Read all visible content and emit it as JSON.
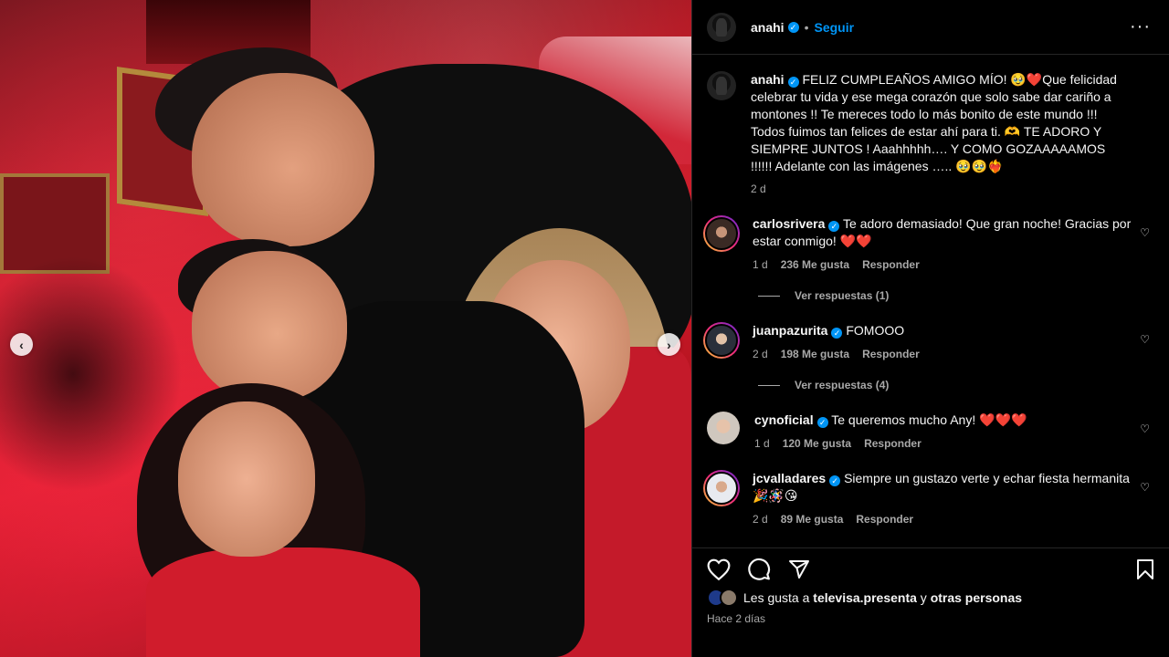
{
  "header": {
    "username": "anahi",
    "follow_label": "Seguir",
    "more_icon": "···"
  },
  "caption": {
    "username": "anahi",
    "text": "FELIZ CUMPLEAÑOS AMIGO MÍO! 🥹❤️Que felicidad celebrar tu vida y ese mega corazón que solo sabe dar cariño a montones !! Te mereces todo lo más bonito de este mundo !!! Todos fuimos tan felices de estar ahí para ti. 🫶 TE ADORO Y SIEMPRE JUNTOS ! Aaahhhhh…. Y COMO GOZAAAAAMOS !!!!!! Adelante con las imágenes ….. 🥹🥹❤️‍🔥",
    "time": "2 d"
  },
  "comments": [
    {
      "username": "carlosrivera",
      "text": "Te adoro demasiado! Que gran noche! Gracias por estar conmigo! ❤️❤️",
      "time": "1 d",
      "likes": "236 Me gusta",
      "reply": "Responder",
      "view_replies": "Ver respuestas (1)"
    },
    {
      "username": "juanpazurita",
      "text": "FOMOOO",
      "time": "2 d",
      "likes": "198 Me gusta",
      "reply": "Responder",
      "view_replies": "Ver respuestas (4)"
    },
    {
      "username": "cynoficial",
      "text": "Te queremos mucho Any! ❤️❤️❤️",
      "time": "1 d",
      "likes": "120 Me gusta",
      "reply": "Responder"
    },
    {
      "username": "jcvalladares",
      "text": "Siempre un gustazo verte y echar fiesta hermanita 🎉🪅😘",
      "time": "2 d",
      "likes": "89 Me gusta",
      "reply": "Responder"
    }
  ],
  "likes_line": {
    "prefix": "Les gusta a",
    "user": "televisa.presenta",
    "conj": "y",
    "others": "otras personas"
  },
  "post_time": "Hace 2 días",
  "carousel": {
    "prev": "‹",
    "next": "›"
  },
  "colors": {
    "accent": "#0095f6",
    "background": "#000000",
    "secondary_text": "#a8a8a8"
  }
}
